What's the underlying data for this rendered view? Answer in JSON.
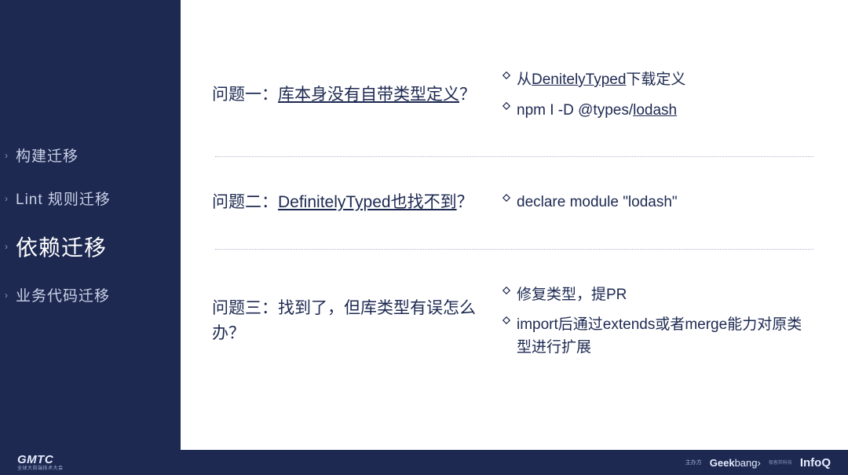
{
  "sidebar": {
    "items": [
      {
        "label": "构建迁移"
      },
      {
        "label": "Lint 规则迁移"
      },
      {
        "label": "依赖迁移"
      },
      {
        "label": "业务代码迁移"
      }
    ],
    "active_index": 2
  },
  "sections": [
    {
      "question_prefix": "问题一：",
      "question_underline": "库本身没有自带类型定义",
      "question_suffix": "？",
      "answers": [
        {
          "pre": "从",
          "ul": "DenitelyTyped",
          "post": "下载定义"
        },
        {
          "pre": "npm I -D @types/",
          "ul": "lodash",
          "post": ""
        }
      ]
    },
    {
      "question_prefix": "问题二：",
      "question_underline": "DefinitelyTyped也找不到",
      "question_suffix": "？",
      "answers": [
        {
          "pre": "declare module \"lodash\"",
          "ul": "",
          "post": ""
        }
      ]
    },
    {
      "question_prefix": "问题三：找到了，但库类型有误怎么办？",
      "question_underline": "",
      "question_suffix": "",
      "answers": [
        {
          "pre": "修复类型，提PR",
          "ul": "",
          "post": ""
        },
        {
          "pre": "import后通过extends或者merge能力对原类型进行扩展",
          "ul": "",
          "post": ""
        }
      ]
    }
  ],
  "footer": {
    "logo_main": "GMTC",
    "logo_sub": "全球大前端技术大会",
    "host_label": "主办方",
    "host_sub": "极客邦科技",
    "brand1_a": "Geek",
    "brand1_b": "bang›",
    "brand2": "InfoQ"
  }
}
